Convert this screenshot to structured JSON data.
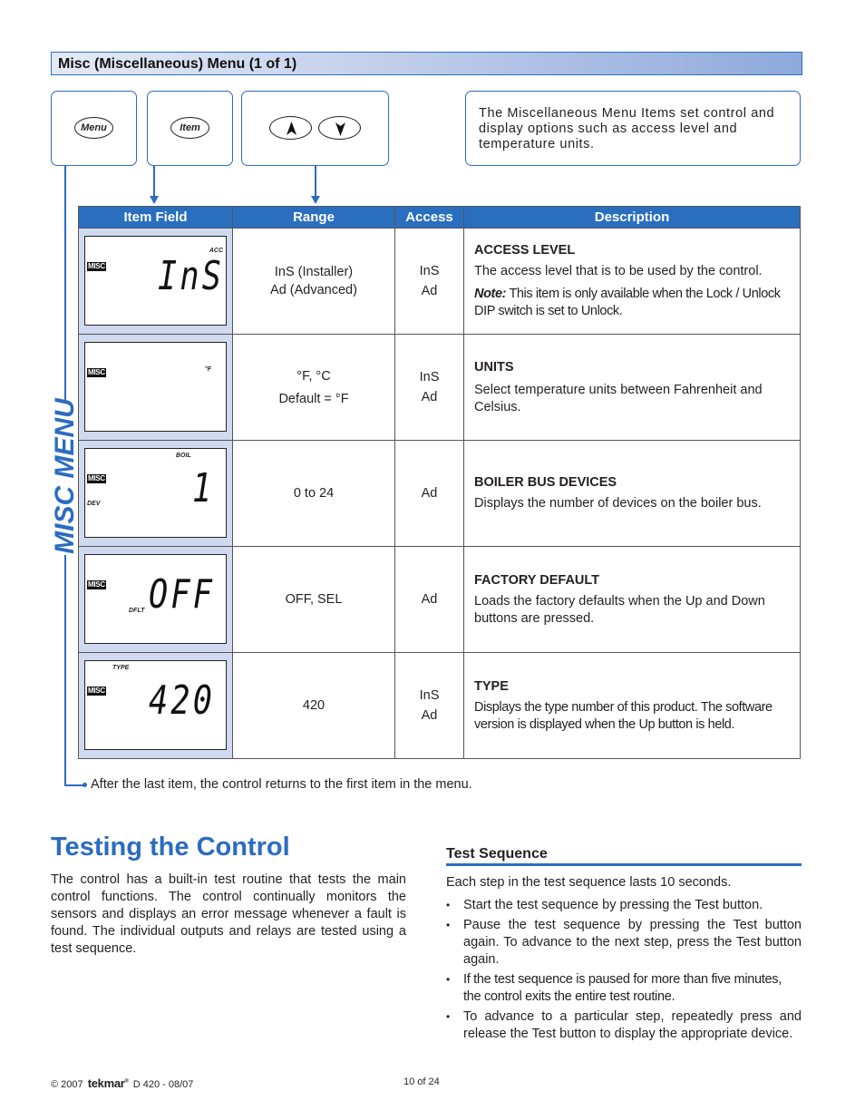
{
  "section_title": "Misc (Miscellaneous) Menu (1 of 1)",
  "buttons": {
    "menu_label": "Menu",
    "item_label": "Item",
    "up_icon": "up-arrow-icon",
    "down_icon": "down-arrow-icon"
  },
  "info_box": "The Miscellaneous Menu Items set control and display options such as access level and temperature units.",
  "side_label": "MISC MENU",
  "table": {
    "headers": [
      "Item Field",
      "Range",
      "Access",
      "Description"
    ],
    "rows": [
      {
        "lcd": {
          "tag": "MISC",
          "big": "InS",
          "small_top": "ACC",
          "small_bottom": ""
        },
        "range": [
          "InS (Installer)",
          "Ad (Advanced)"
        ],
        "access": [
          "InS",
          "Ad"
        ],
        "title": "ACCESS LEVEL",
        "body": "The access level that is to be used by the control.",
        "note_label": "Note:",
        "note_text": "This item is only available when the Lock / Unlock DIP switch is set to Unlock."
      },
      {
        "lcd": {
          "tag": "MISC",
          "big": "",
          "small_top": "°F",
          "small_bottom": ""
        },
        "range": [
          "°F, °C",
          "Default = °F"
        ],
        "access": [
          "InS",
          "Ad"
        ],
        "title": "UNITS",
        "body": "Select temperature units between Fahrenheit and Celsius."
      },
      {
        "lcd": {
          "tag": "MISC",
          "big": "1",
          "small_top": "BOIL",
          "small_bottom": "DEV"
        },
        "range": [
          "0 to 24"
        ],
        "access": [
          "Ad"
        ],
        "title": "BOILER BUS DEVICES",
        "body": "Displays the number of devices on the boiler bus."
      },
      {
        "lcd": {
          "tag": "MISC",
          "big": "OFF",
          "small_top": "",
          "small_bottom": "DFLT"
        },
        "range": [
          "OFF, SEL"
        ],
        "access": [
          "Ad"
        ],
        "title": "FACTORY DEFAULT",
        "body": "Loads the factory defaults when the Up and Down buttons are pressed."
      },
      {
        "lcd": {
          "tag": "MISC",
          "big": "420",
          "small_top": "TYPE",
          "small_bottom": ""
        },
        "range": [
          "420"
        ],
        "access": [
          "InS",
          "Ad"
        ],
        "title": "TYPE",
        "body": "Displays the type number of this product. The software version is displayed when the Up button is held."
      }
    ]
  },
  "after_note": "After the last item, the control returns to the first item in the menu.",
  "testing": {
    "heading": "Testing the Control",
    "paragraph": "The control has a built-in test routine that tests the main control functions. The control continually monitors the sensors and displays an error message whenever a fault is found. The individual outputs and relays are tested using a test sequence."
  },
  "test_sequence": {
    "heading": "Test Sequence",
    "intro": "Each step in the test sequence lasts 10 seconds.",
    "bullets": [
      "Start the test sequence by pressing the Test button.",
      "Pause the test sequence by pressing the Test button again. To advance to the next step, press the Test button again.",
      "If the test sequence is paused for more than five minutes, the control exits the entire test routine.",
      "To advance to a particular step, repeatedly press and release the Test button to display the appropriate device."
    ]
  },
  "footer": {
    "copyright": "© 2007",
    "brand": "tekmar",
    "brand_mark": "®",
    "doc": "D 420 - 08/07",
    "page": "10 of 24"
  },
  "colors": {
    "accent_blue": "#2b6cc0",
    "header_blue": "#2a6fbf",
    "lcd_cell_bg": "#cfd9ef"
  }
}
